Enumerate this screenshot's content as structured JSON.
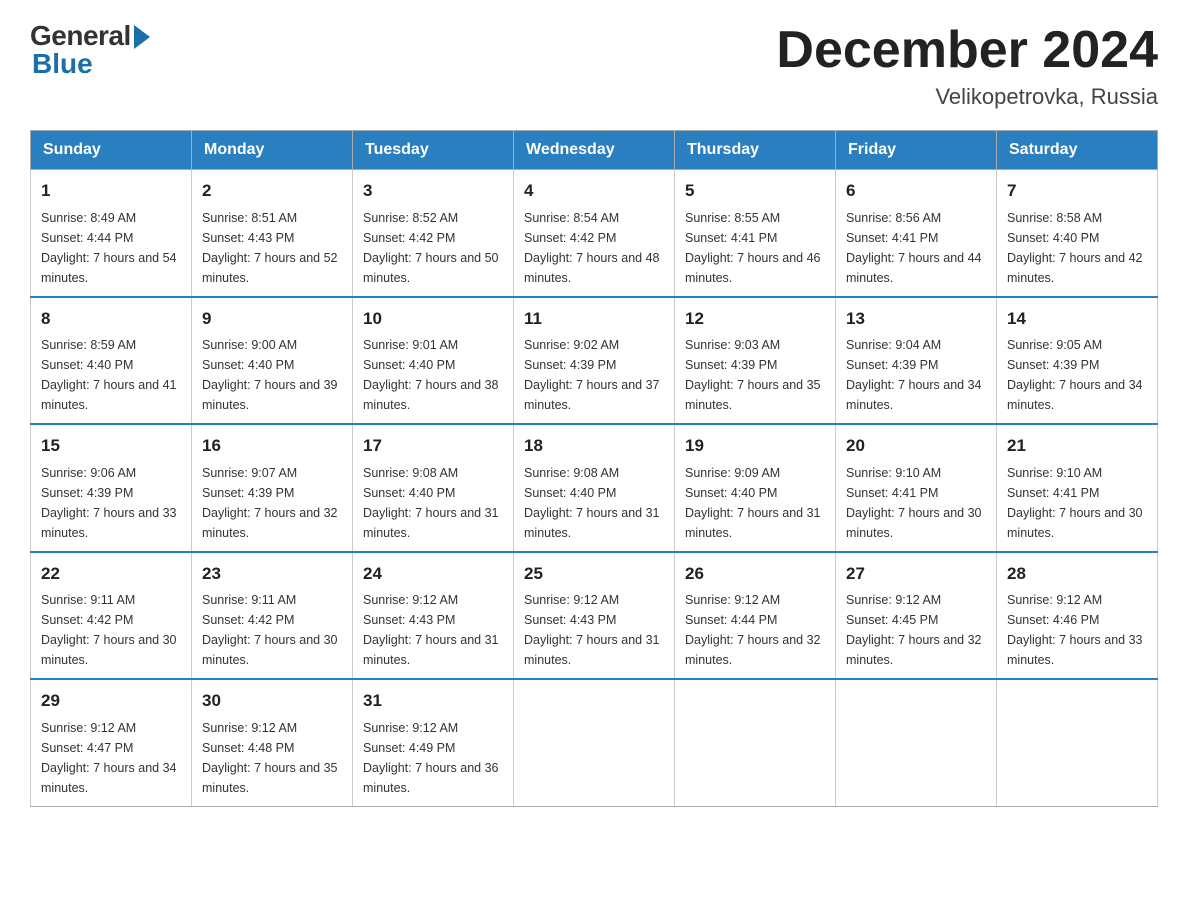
{
  "header": {
    "logo": {
      "general": "General",
      "blue": "Blue"
    },
    "title": "December 2024",
    "location": "Velikopetrovka, Russia"
  },
  "calendar": {
    "days_of_week": [
      "Sunday",
      "Monday",
      "Tuesday",
      "Wednesday",
      "Thursday",
      "Friday",
      "Saturday"
    ],
    "weeks": [
      [
        {
          "day": "1",
          "sunrise": "8:49 AM",
          "sunset": "4:44 PM",
          "daylight": "7 hours and 54 minutes."
        },
        {
          "day": "2",
          "sunrise": "8:51 AM",
          "sunset": "4:43 PM",
          "daylight": "7 hours and 52 minutes."
        },
        {
          "day": "3",
          "sunrise": "8:52 AM",
          "sunset": "4:42 PM",
          "daylight": "7 hours and 50 minutes."
        },
        {
          "day": "4",
          "sunrise": "8:54 AM",
          "sunset": "4:42 PM",
          "daylight": "7 hours and 48 minutes."
        },
        {
          "day": "5",
          "sunrise": "8:55 AM",
          "sunset": "4:41 PM",
          "daylight": "7 hours and 46 minutes."
        },
        {
          "day": "6",
          "sunrise": "8:56 AM",
          "sunset": "4:41 PM",
          "daylight": "7 hours and 44 minutes."
        },
        {
          "day": "7",
          "sunrise": "8:58 AM",
          "sunset": "4:40 PM",
          "daylight": "7 hours and 42 minutes."
        }
      ],
      [
        {
          "day": "8",
          "sunrise": "8:59 AM",
          "sunset": "4:40 PM",
          "daylight": "7 hours and 41 minutes."
        },
        {
          "day": "9",
          "sunrise": "9:00 AM",
          "sunset": "4:40 PM",
          "daylight": "7 hours and 39 minutes."
        },
        {
          "day": "10",
          "sunrise": "9:01 AM",
          "sunset": "4:40 PM",
          "daylight": "7 hours and 38 minutes."
        },
        {
          "day": "11",
          "sunrise": "9:02 AM",
          "sunset": "4:39 PM",
          "daylight": "7 hours and 37 minutes."
        },
        {
          "day": "12",
          "sunrise": "9:03 AM",
          "sunset": "4:39 PM",
          "daylight": "7 hours and 35 minutes."
        },
        {
          "day": "13",
          "sunrise": "9:04 AM",
          "sunset": "4:39 PM",
          "daylight": "7 hours and 34 minutes."
        },
        {
          "day": "14",
          "sunrise": "9:05 AM",
          "sunset": "4:39 PM",
          "daylight": "7 hours and 34 minutes."
        }
      ],
      [
        {
          "day": "15",
          "sunrise": "9:06 AM",
          "sunset": "4:39 PM",
          "daylight": "7 hours and 33 minutes."
        },
        {
          "day": "16",
          "sunrise": "9:07 AM",
          "sunset": "4:39 PM",
          "daylight": "7 hours and 32 minutes."
        },
        {
          "day": "17",
          "sunrise": "9:08 AM",
          "sunset": "4:40 PM",
          "daylight": "7 hours and 31 minutes."
        },
        {
          "day": "18",
          "sunrise": "9:08 AM",
          "sunset": "4:40 PM",
          "daylight": "7 hours and 31 minutes."
        },
        {
          "day": "19",
          "sunrise": "9:09 AM",
          "sunset": "4:40 PM",
          "daylight": "7 hours and 31 minutes."
        },
        {
          "day": "20",
          "sunrise": "9:10 AM",
          "sunset": "4:41 PM",
          "daylight": "7 hours and 30 minutes."
        },
        {
          "day": "21",
          "sunrise": "9:10 AM",
          "sunset": "4:41 PM",
          "daylight": "7 hours and 30 minutes."
        }
      ],
      [
        {
          "day": "22",
          "sunrise": "9:11 AM",
          "sunset": "4:42 PM",
          "daylight": "7 hours and 30 minutes."
        },
        {
          "day": "23",
          "sunrise": "9:11 AM",
          "sunset": "4:42 PM",
          "daylight": "7 hours and 30 minutes."
        },
        {
          "day": "24",
          "sunrise": "9:12 AM",
          "sunset": "4:43 PM",
          "daylight": "7 hours and 31 minutes."
        },
        {
          "day": "25",
          "sunrise": "9:12 AM",
          "sunset": "4:43 PM",
          "daylight": "7 hours and 31 minutes."
        },
        {
          "day": "26",
          "sunrise": "9:12 AM",
          "sunset": "4:44 PM",
          "daylight": "7 hours and 32 minutes."
        },
        {
          "day": "27",
          "sunrise": "9:12 AM",
          "sunset": "4:45 PM",
          "daylight": "7 hours and 32 minutes."
        },
        {
          "day": "28",
          "sunrise": "9:12 AM",
          "sunset": "4:46 PM",
          "daylight": "7 hours and 33 minutes."
        }
      ],
      [
        {
          "day": "29",
          "sunrise": "9:12 AM",
          "sunset": "4:47 PM",
          "daylight": "7 hours and 34 minutes."
        },
        {
          "day": "30",
          "sunrise": "9:12 AM",
          "sunset": "4:48 PM",
          "daylight": "7 hours and 35 minutes."
        },
        {
          "day": "31",
          "sunrise": "9:12 AM",
          "sunset": "4:49 PM",
          "daylight": "7 hours and 36 minutes."
        },
        null,
        null,
        null,
        null
      ]
    ]
  }
}
